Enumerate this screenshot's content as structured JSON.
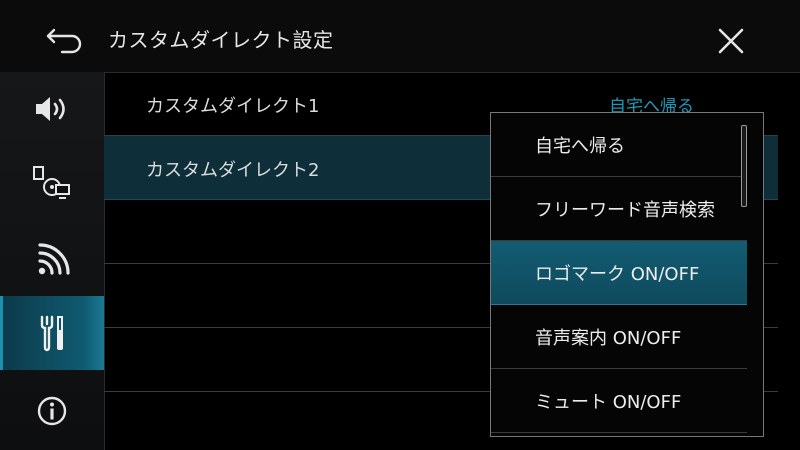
{
  "header": {
    "title": "カスタムダイレクト設定",
    "back_icon": "back-arrow-icon",
    "close_icon": "close-icon"
  },
  "sidebar": {
    "items": [
      {
        "name": "sidebar-item-audio",
        "icon": "speaker-icon",
        "active": false
      },
      {
        "name": "sidebar-item-source",
        "icon": "media-source-icon",
        "active": false
      },
      {
        "name": "sidebar-item-connectivity",
        "icon": "wireless-icon",
        "active": false
      },
      {
        "name": "sidebar-item-settings",
        "icon": "tools-icon",
        "active": true
      },
      {
        "name": "sidebar-item-info",
        "icon": "info-icon",
        "active": false
      }
    ]
  },
  "list": {
    "rows": [
      {
        "label": "カスタムダイレクト1",
        "value": "自宅へ帰る"
      },
      {
        "label": "カスタムダイレクト2",
        "value": ""
      }
    ]
  },
  "dropdown": {
    "options": [
      {
        "label": "自宅へ帰る"
      },
      {
        "label": "フリーワード音声検索"
      },
      {
        "label": "ロゴマーク ON/OFF"
      },
      {
        "label": "音声案内 ON/OFF"
      },
      {
        "label": "ミュート ON/OFF"
      }
    ],
    "highlighted_index": 2
  },
  "colors": {
    "accent": "#1e98b8",
    "highlight": "#125c72",
    "background": "#000000"
  }
}
